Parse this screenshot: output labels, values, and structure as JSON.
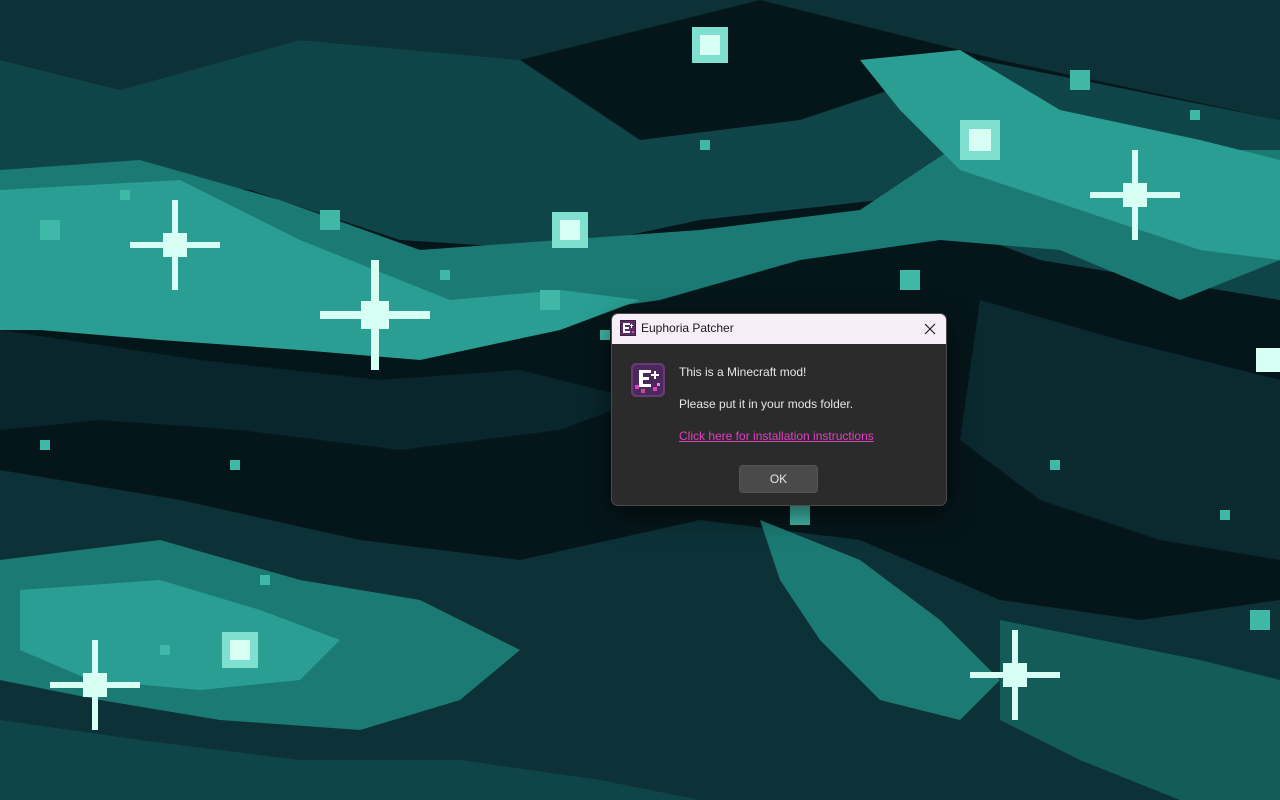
{
  "desktop": {
    "wallpaper": "pixel-art teal galaxy nebula with sparkling stars",
    "colors": {
      "base": "#05161a",
      "dark": "#0a2a30",
      "mid": "#0f4a4f",
      "teal": "#1f8a80",
      "light": "#3fb8a8",
      "star": "#d8fff4"
    }
  },
  "dialog": {
    "title": "Euphoria Patcher",
    "title_icon": "euphoria-app-icon",
    "close_icon": "close-icon",
    "body_icon": "euphoria-e-plus-icon",
    "message_line1": "This is a Minecraft mod!",
    "message_line2": "Please put it in your mods folder.",
    "link_text": "Click here for installation instructions",
    "ok_label": "OK",
    "colors": {
      "titlebar": "#f7eef7",
      "body": "#2b2b2b",
      "link": "#e040c0",
      "button": "#4a4a4a"
    }
  }
}
